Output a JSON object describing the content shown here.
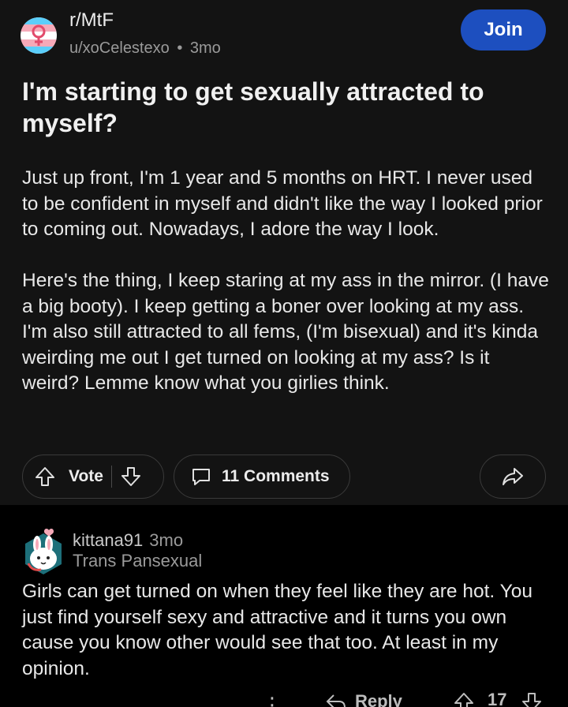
{
  "post": {
    "subreddit": "r/MtF",
    "author": "u/xoCelestexo",
    "separator": "•",
    "age": "3mo",
    "join_label": "Join",
    "title": "I'm starting to get sexually attracted to myself?",
    "body": [
      "Just up front, I'm 1 year and 5 months on HRT. I never used to be confident in myself and didn't like the way I looked prior to coming out. Nowadays, I adore the way I look.",
      "Here's the thing, I keep staring at my ass in the mirror. (I have a big booty). I keep getting a boner over looking at my ass. I'm also still attracted to all fems, (I'm bisexual) and it's kinda weirding me out I get turned on looking at my ass? Is it weird? Lemme know what you girlies think."
    ],
    "actions": {
      "vote_label": "Vote",
      "comments_label": "11 Comments"
    },
    "icons": {
      "subreddit_avatar": "trans-flag-venus-icon",
      "upvote": "arrow-up-outline-icon",
      "downvote": "arrow-down-outline-icon",
      "comments": "speech-bubble-icon",
      "share": "share-arrow-icon"
    }
  },
  "comment": {
    "username": "kittana91",
    "age": "3mo",
    "flair": "Trans Pansexual",
    "text": "Girls can get turned on when they feel like they are hot. You just find yourself sexy and attractive and it turns you own cause you know other would see that too. At least in my opinion.",
    "actions": {
      "more": "⋮",
      "reply_label": "Reply",
      "score": "17"
    },
    "icons": {
      "avatar": "bunny-avatar-icon",
      "more": "more-vertical-icon",
      "reply": "reply-arrow-icon",
      "upvote": "arrow-up-outline-icon",
      "downvote": "arrow-down-outline-icon"
    }
  },
  "colors": {
    "post_background": "#131313",
    "page_background": "#000000",
    "join_button": "#1d4fbf",
    "trans_blue": "#5bcefa",
    "trans_pink": "#f5a9b8",
    "venus_red": "#e24a6b"
  }
}
